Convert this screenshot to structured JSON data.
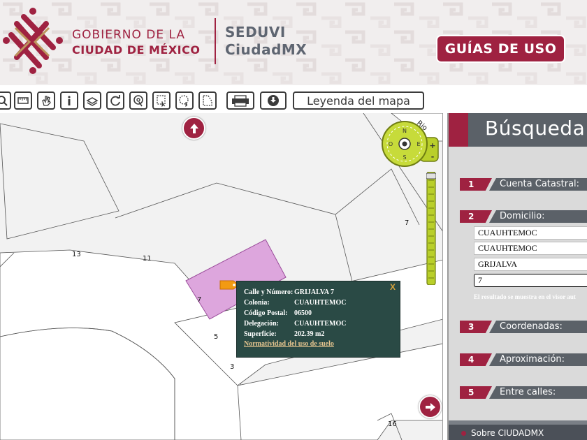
{
  "header": {
    "gov_line1": "GOBIERNO DE LA",
    "gov_line2": "CIUDAD DE MÉXICO",
    "seduvi_line1": "SEDUVI",
    "seduvi_line2": "CiudadMX",
    "guias_button": "GUÍAS DE USO"
  },
  "toolbar": {
    "tools": [
      "zoom-icon",
      "measure-ruler-icon",
      "hand-pan-icon",
      "info-icon",
      "layers-icon",
      "refresh-icon",
      "locate-icon",
      "select-rectangle-icon",
      "select-circle-icon",
      "select-polygon-icon",
      "print-icon",
      "download-icon"
    ],
    "legend_button": "Leyenda del mapa"
  },
  "map": {
    "street_label": "Rio",
    "compass": {
      "n": "N",
      "s": "S",
      "e": "E",
      "o": "O",
      "plus": "+",
      "minus": "-"
    },
    "lot_numbers": [
      "13",
      "11",
      "7",
      "5",
      "3",
      "7",
      "16"
    ],
    "popup": {
      "close": "X",
      "rows": [
        {
          "key": "Calle y Número:",
          "value": "GRIJALVA 7"
        },
        {
          "key": "Colonia:",
          "value": "CUAUHTEMOC"
        },
        {
          "key": "Código Postal:",
          "value": "06500"
        },
        {
          "key": "Delegación:",
          "value": "CUAUHTEMOC"
        },
        {
          "key": "Superficie:",
          "value": "202.39 m2"
        }
      ],
      "link": "Normatividad del uso de suelo"
    },
    "colors": {
      "selected_lot": "#dda6dd",
      "popup_bg": "#2a4a45",
      "accent": "#9f2241"
    }
  },
  "panel": {
    "title": "Búsqueda",
    "steps": [
      {
        "num": "1",
        "label": "Cuenta Catastral:"
      },
      {
        "num": "2",
        "label": "Domicilio:"
      },
      {
        "num": "3",
        "label": "Coordenadas:"
      },
      {
        "num": "4",
        "label": "Aproximación:"
      },
      {
        "num": "5",
        "label": "Entre calles:"
      }
    ],
    "fields": [
      "CUAUHTEMOC",
      "CUAUHTEMOC",
      "GRIJALVA",
      "7"
    ],
    "note": "El resultado se muestra en el visor aut",
    "footer": "Sobre CIUDADMX"
  }
}
